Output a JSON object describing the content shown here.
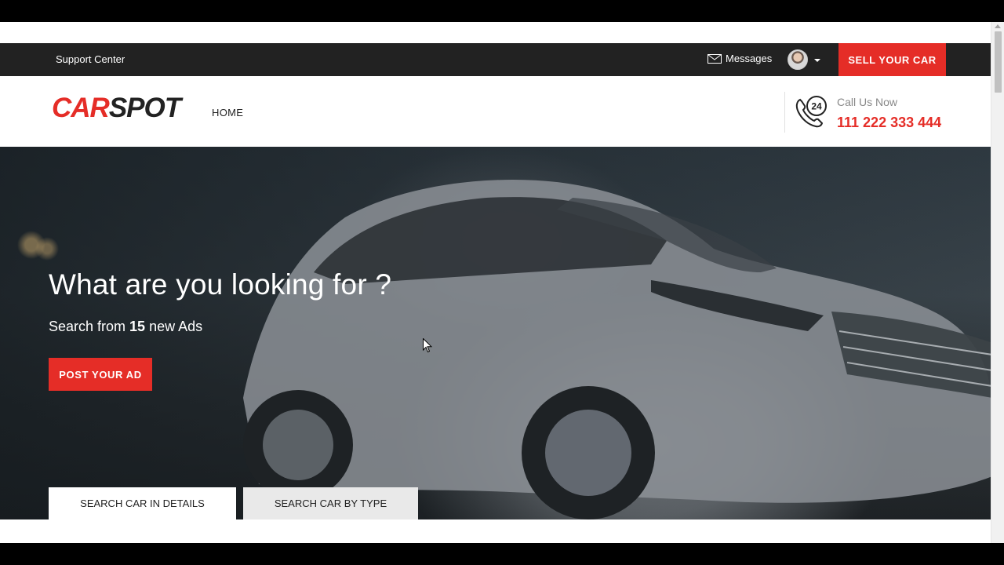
{
  "topbar": {
    "support_label": "Support Center",
    "messages_label": "Messages",
    "sell_label": "SELL YOUR CAR"
  },
  "header": {
    "logo_car": "CAR",
    "logo_spot": "SPOT",
    "nav_home": "HOME",
    "call_label": "Call Us Now",
    "call_number": "111 222 333 444",
    "phone_badge": "24"
  },
  "hero": {
    "title": "What are you looking for ?",
    "subtitle_prefix": "Search from ",
    "ads_count": "15",
    "subtitle_suffix": " new Ads",
    "post_label": "POST YOUR AD"
  },
  "tabs": [
    {
      "label": "SEARCH CAR IN DETAILS",
      "active": true
    },
    {
      "label": "SEARCH CAR BY TYPE",
      "active": false
    }
  ],
  "colors": {
    "accent": "#e52d27",
    "topbar": "#222222"
  }
}
